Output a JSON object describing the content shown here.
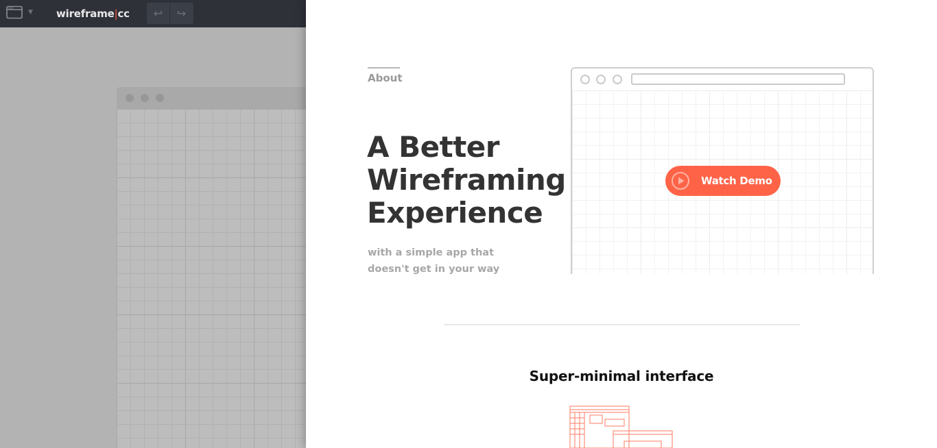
{
  "toolbar": {
    "logo_left": "wireframe",
    "logo_sep": "|",
    "logo_right": "cc",
    "icons": {
      "window": "window-icon",
      "dropdown": "chevron-down-icon",
      "undo": "undo-icon",
      "redo": "redo-icon"
    },
    "undo_glyph": "↩",
    "redo_glyph": "↪",
    "caret_glyph": "▼"
  },
  "canvas": {
    "frame_window_dots": 3
  },
  "panel": {
    "about_label": "About",
    "hero_title_lines": [
      "A Better",
      "Wireframing",
      "Experience"
    ],
    "hero_subtitle_lines": [
      "with a simple app that",
      "doesn't get in your way"
    ],
    "demo": {
      "button_label": "Watch Demo",
      "icon": "play-icon"
    },
    "feature_title": "Super-minimal interface",
    "feature_icon": "wireframe-illustration-icon"
  },
  "colors": {
    "accent": "#ff6347",
    "toolbar_bg": "#2e3138",
    "canvas_bg": "#b3b3b3",
    "panel_bg": "#ffffff",
    "heading": "#333333",
    "muted_text": "#a7a7a7"
  }
}
